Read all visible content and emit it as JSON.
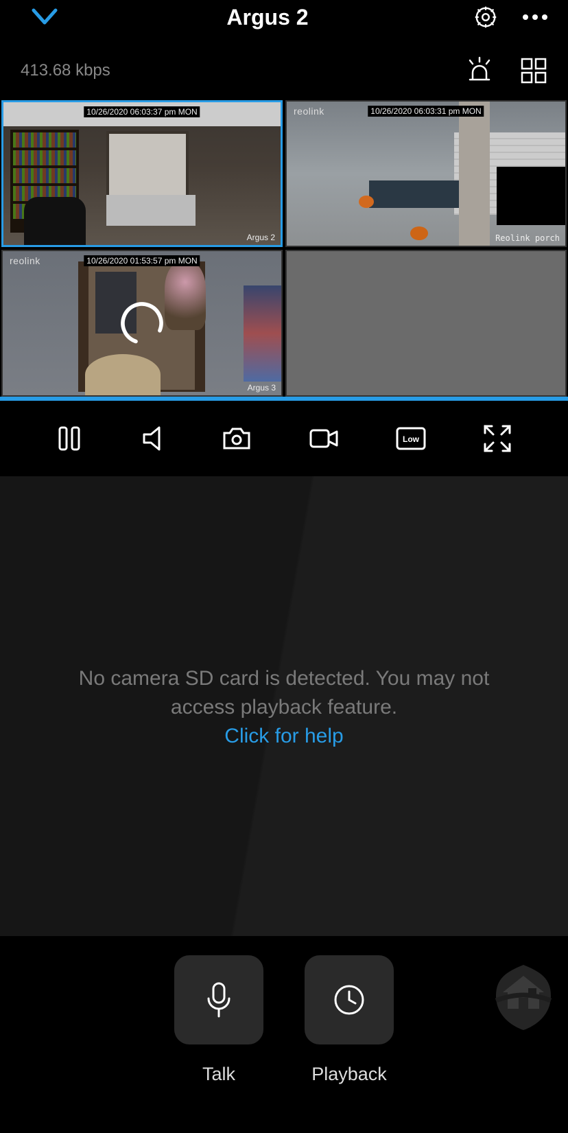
{
  "header": {
    "title": "Argus 2"
  },
  "subheader": {
    "bitrate": "413.68 kbps"
  },
  "cameras": [
    {
      "brand": "",
      "timestamp": "10/26/2020 06:03:37 pm MON",
      "name": "Argus 2",
      "selected": true
    },
    {
      "brand": "reolink",
      "timestamp": "10/26/2020 06:03:31 pm MON",
      "name": "Reolink porch",
      "selected": false
    },
    {
      "brand": "reolink",
      "timestamp": "10/26/2020 01:53:57 pm MON",
      "name": "Argus 3",
      "selected": false,
      "loading": true
    },
    {
      "empty": true
    }
  ],
  "controls": {
    "quality_label": "Low"
  },
  "message": {
    "line1": "No camera SD card is detected. You may not",
    "line2": "access playback feature.",
    "help_link": "Click for help"
  },
  "actions": {
    "talk": "Talk",
    "playback": "Playback"
  }
}
